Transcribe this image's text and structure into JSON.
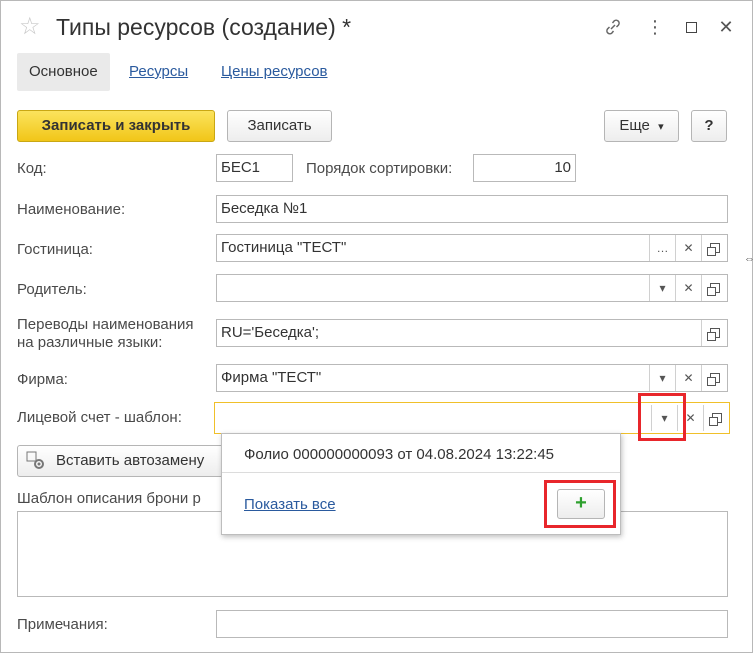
{
  "window": {
    "title": "Типы ресурсов (создание) *",
    "star_icon": "☆",
    "link_icon": "🔗",
    "more_icon": "⋮",
    "maximize_icon": "☐",
    "close_icon": "✕"
  },
  "tabs": [
    {
      "label": "Основное",
      "active": true
    },
    {
      "label": "Ресурсы",
      "active": false
    },
    {
      "label": "Цены ресурсов",
      "active": false
    }
  ],
  "toolbar": {
    "save_close_label": "Записать и закрыть",
    "save_label": "Записать",
    "more_label": "Еще",
    "more_arrow": "▾",
    "help_label": "?"
  },
  "form": {
    "code_label": "Код:",
    "code_value": "БЕС1",
    "sort_label": "Порядок сортировки:",
    "sort_value": "10",
    "name_label": "Наименование:",
    "name_value": "Беседка №1",
    "hotel_label": "Гостиница:",
    "hotel_value": "Гостиница \"ТЕСТ\"",
    "parent_label": "Родитель:",
    "parent_value": "",
    "translations_label_1": "Переводы наименования",
    "translations_label_2": "на различные языки:",
    "translations_value": "RU='Беседка';",
    "firm_label": "Фирма:",
    "firm_value": "Фирма \"ТЕСТ\"",
    "account_label": "Лицевой счет - шаблон:",
    "account_value": "",
    "insert_label": "Вставить автозамену",
    "template_label": "Шаблон описания брони р",
    "notes_label": "Примечания:",
    "notes_value": ""
  },
  "dropdown": {
    "item": "Фолио 000000000093 от 04.08.2024 13:22:45",
    "show_all": "Показать все",
    "add_icon": "+"
  },
  "colors": {
    "primary_button": "#f5d130",
    "link": "#2a5a9e",
    "highlight": "#e8262b",
    "focus_border": "#f0c02a",
    "add_plus": "#2ea02e"
  }
}
